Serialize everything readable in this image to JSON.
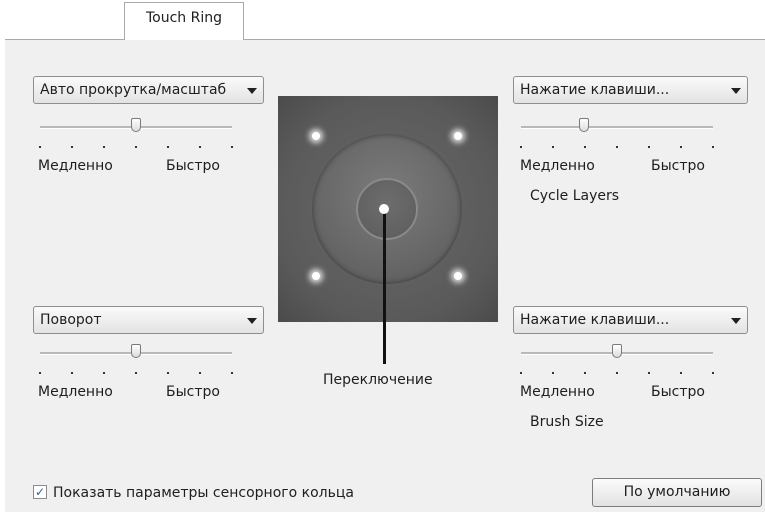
{
  "tabs": [
    {
      "label": "Touch Ring"
    }
  ],
  "top_left": {
    "combo": "Авто прокрутка/масштаб",
    "slider": {
      "min_label": "Медленно",
      "max_label": "Быстро",
      "value_fraction": 0.5
    }
  },
  "bottom_left": {
    "combo": "Поворот",
    "slider": {
      "min_label": "Медленно",
      "max_label": "Быстро",
      "value_fraction": 0.5
    }
  },
  "top_right": {
    "combo": "Нажатие клавиши...",
    "slider": {
      "min_label": "Медленно",
      "max_label": "Быстро",
      "value_fraction": 0.33
    },
    "caption": "Cycle Layers"
  },
  "bottom_right": {
    "combo": "Нажатие клавиши...",
    "slider": {
      "min_label": "Медленно",
      "max_label": "Быстро",
      "value_fraction": 0.5
    },
    "caption": "Brush Size"
  },
  "center": {
    "toggle_label": "Переключение"
  },
  "footer": {
    "show_settings_label": "Показать параметры сенсорного кольца",
    "show_settings_checked": true,
    "default_button": "По умолчанию"
  },
  "colors": {
    "panel": "#f0f0f0",
    "ring": "#5a5a5a",
    "check": "#2b5ea8"
  }
}
